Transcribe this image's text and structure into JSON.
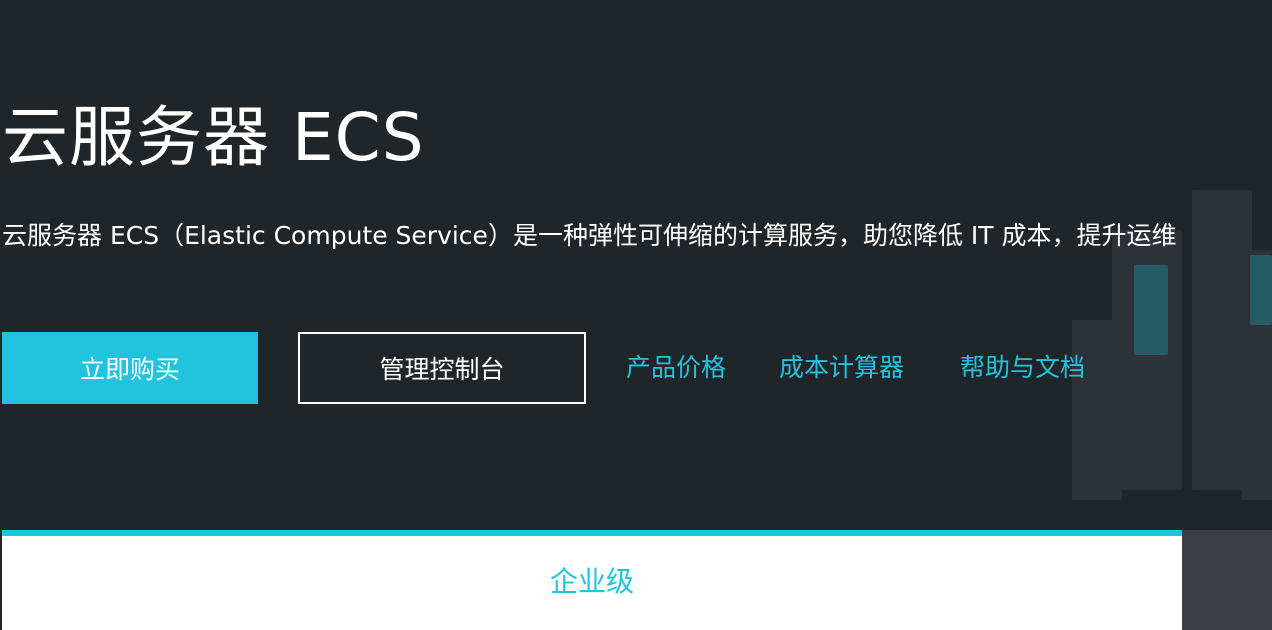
{
  "hero": {
    "title": "云服务器 ECS",
    "description": "云服务器 ECS（Elastic Compute Service）是一种弹性可伸缩的计算服务，助您降低 IT 成本，提升运维",
    "buttons": {
      "buy_label": "立即购买",
      "console_label": "管理控制台"
    },
    "links": [
      {
        "label": "产品价格"
      },
      {
        "label": "成本计算器"
      },
      {
        "label": "帮助与文档"
      }
    ]
  },
  "tabs": [
    {
      "label": "企业级",
      "active": true
    }
  ],
  "colors": {
    "background": "#20252a",
    "accent": "#22c3de",
    "text": "#ffffff",
    "side_panel": "#3a3e42"
  }
}
